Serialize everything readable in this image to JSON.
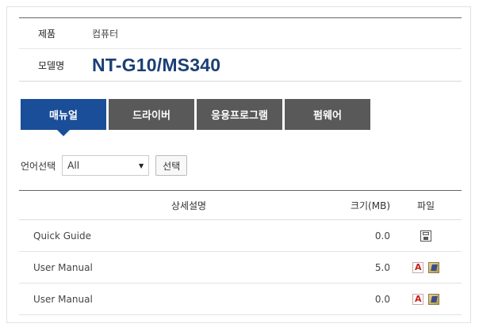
{
  "product": {
    "category_label": "제품",
    "category_value": "컴퓨터",
    "model_label": "모델명",
    "model_value": "NT-G10/MS340"
  },
  "tabs": [
    {
      "label": "매뉴얼",
      "active": true
    },
    {
      "label": "드라이버",
      "active": false
    },
    {
      "label": "응용프로그램",
      "active": false
    },
    {
      "label": "펌웨어",
      "active": false
    }
  ],
  "language": {
    "label": "언어선택",
    "selected": "All",
    "button_label": "선택"
  },
  "table": {
    "headers": {
      "desc": "상세설명",
      "size": "크기(MB)",
      "file": "파일"
    },
    "rows": [
      {
        "desc": "Quick Guide",
        "size": "0.0",
        "files": [
          "save-icon"
        ]
      },
      {
        "desc": "User Manual",
        "size": "5.0",
        "files": [
          "pdf-icon",
          "download-icon"
        ]
      },
      {
        "desc": "User Manual",
        "size": "0.0",
        "files": [
          "pdf-icon",
          "download-icon"
        ]
      }
    ]
  },
  "colors": {
    "active_tab": "#1a4e98",
    "inactive_tab": "#595959",
    "model_text": "#1a3f75"
  }
}
